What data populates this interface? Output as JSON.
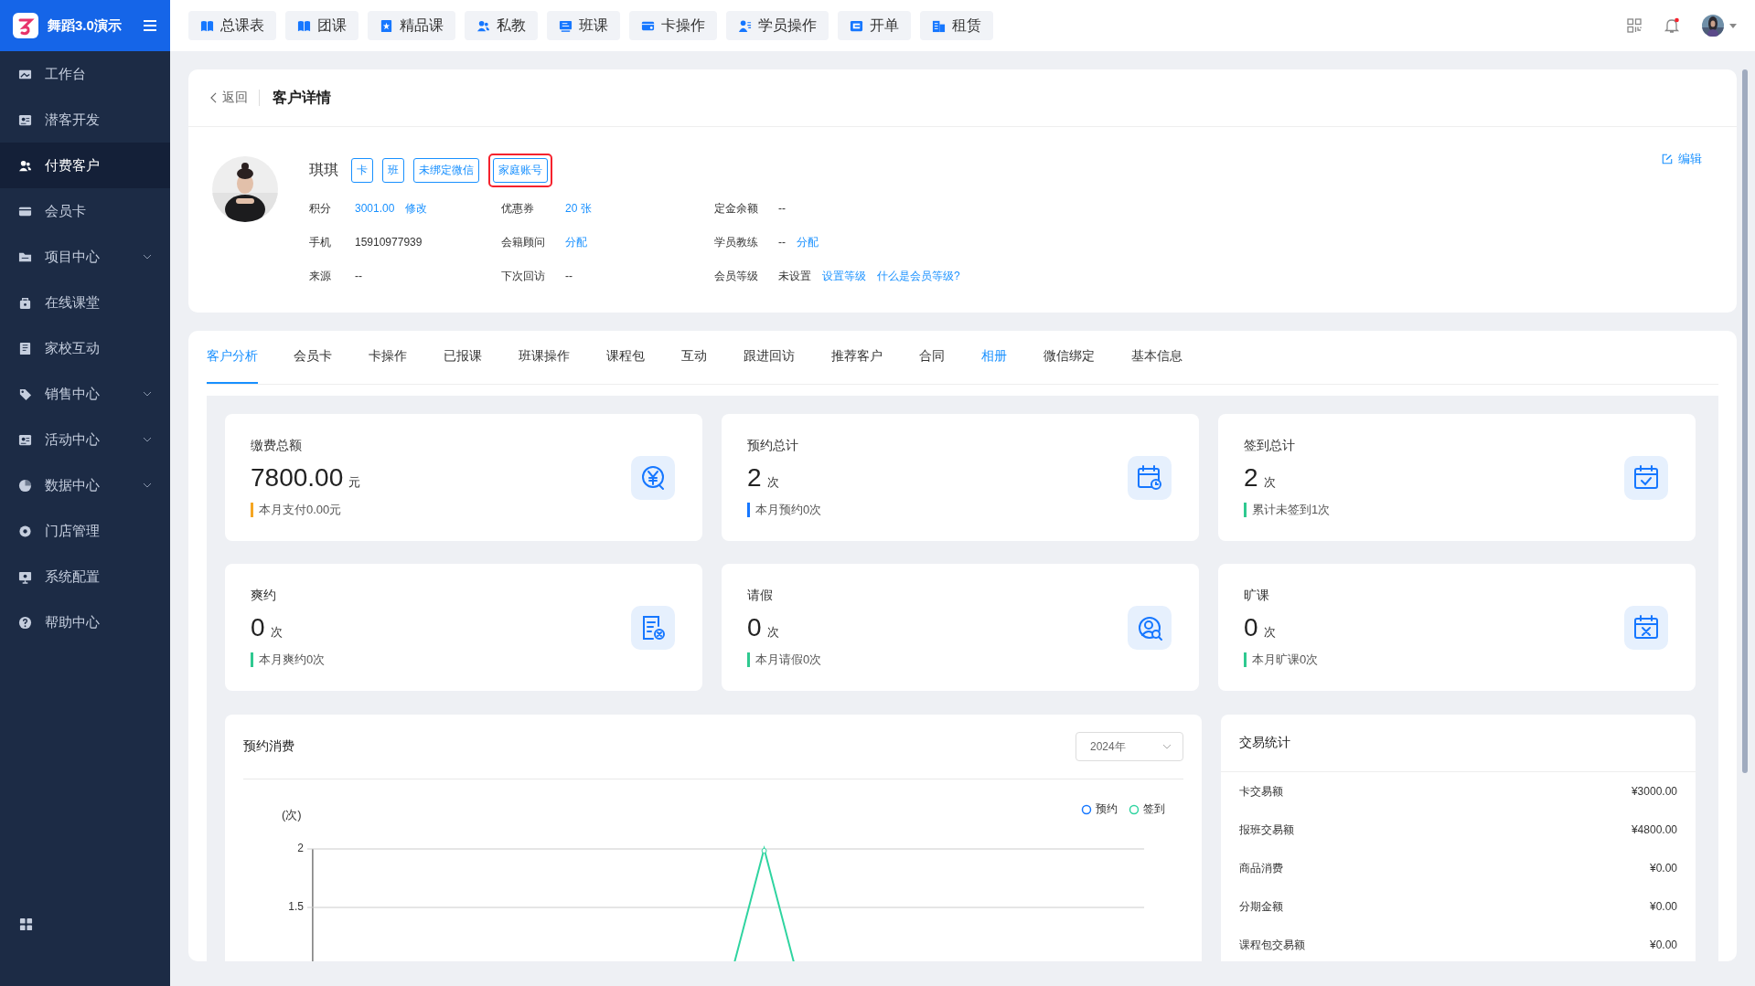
{
  "app": {
    "title": "舞蹈3.0演示"
  },
  "top_nav": [
    {
      "label": "总课表"
    },
    {
      "label": "团课"
    },
    {
      "label": "精品课"
    },
    {
      "label": "私教"
    },
    {
      "label": "班课"
    },
    {
      "label": "卡操作"
    },
    {
      "label": "学员操作"
    },
    {
      "label": "开单"
    },
    {
      "label": "租赁"
    }
  ],
  "notifications": {
    "unread": true
  },
  "sidebar": {
    "items": [
      {
        "label": "工作台",
        "expandable": false,
        "selected": false
      },
      {
        "label": "潜客开发",
        "expandable": false,
        "selected": false
      },
      {
        "label": "付费客户",
        "expandable": false,
        "selected": true
      },
      {
        "label": "会员卡",
        "expandable": false,
        "selected": false
      },
      {
        "label": "项目中心",
        "expandable": true,
        "selected": false
      },
      {
        "label": "在线课堂",
        "expandable": false,
        "selected": false
      },
      {
        "label": "家校互动",
        "expandable": false,
        "selected": false
      },
      {
        "label": "销售中心",
        "expandable": true,
        "selected": false
      },
      {
        "label": "活动中心",
        "expandable": true,
        "selected": false
      },
      {
        "label": "数据中心",
        "expandable": true,
        "selected": false
      },
      {
        "label": "门店管理",
        "expandable": false,
        "selected": false
      },
      {
        "label": "系统配置",
        "expandable": false,
        "selected": false
      },
      {
        "label": "帮助中心",
        "expandable": false,
        "selected": false
      }
    ]
  },
  "header": {
    "back": "返回",
    "title": "客户详情",
    "edit": "编辑"
  },
  "customer": {
    "name": "琪琪",
    "tags": [
      {
        "label": "卡",
        "highlighted": false
      },
      {
        "label": "班",
        "highlighted": false
      },
      {
        "label": "未绑定微信",
        "highlighted": false
      },
      {
        "label": "家庭账号",
        "highlighted": true
      }
    ],
    "fields": [
      [
        {
          "label": "积分",
          "value": "3001.00",
          "kind": "link",
          "action": "修改"
        },
        {
          "label": "优惠券",
          "value": "20 张",
          "kind": "link"
        },
        {
          "label": "定金余额",
          "value": "--",
          "kind": "text"
        }
      ],
      [
        {
          "label": "手机",
          "value": "15910977939",
          "kind": "text"
        },
        {
          "label": "会籍顾问",
          "value": "分配",
          "kind": "link"
        },
        {
          "label": "学员教练",
          "value": "--",
          "kind": "text",
          "action": "分配"
        }
      ],
      [
        {
          "label": "来源",
          "value": "--",
          "kind": "text"
        },
        {
          "label": "下次回访",
          "value": "--",
          "kind": "text"
        },
        {
          "label": "会员等级",
          "value": "未设置",
          "kind": "text",
          "action": "设置等级",
          "help": "什么是会员等级?"
        }
      ]
    ]
  },
  "tabs": [
    {
      "label": "客户分析",
      "selected": true,
      "highlighted": false
    },
    {
      "label": "会员卡",
      "selected": false,
      "highlighted": false
    },
    {
      "label": "卡操作",
      "selected": false,
      "highlighted": false
    },
    {
      "label": "已报课",
      "selected": false,
      "highlighted": false
    },
    {
      "label": "班课操作",
      "selected": false,
      "highlighted": false
    },
    {
      "label": "课程包",
      "selected": false,
      "highlighted": false
    },
    {
      "label": "互动",
      "selected": false,
      "highlighted": false
    },
    {
      "label": "跟进回访",
      "selected": false,
      "highlighted": false
    },
    {
      "label": "推荐客户",
      "selected": false,
      "highlighted": false
    },
    {
      "label": "合同",
      "selected": false,
      "highlighted": false
    },
    {
      "label": "相册",
      "selected": false,
      "highlighted": true
    },
    {
      "label": "微信绑定",
      "selected": false,
      "highlighted": false
    },
    {
      "label": "基本信息",
      "selected": false,
      "highlighted": false
    }
  ],
  "stats": [
    {
      "title": "缴费总额",
      "value": "7800.00",
      "unit": "元",
      "note": "本月支付0.00元",
      "color": "#f5a623"
    },
    {
      "title": "预约总计",
      "value": "2",
      "unit": "次",
      "note": "本月预约0次",
      "color": "#1677ff"
    },
    {
      "title": "签到总计",
      "value": "2",
      "unit": "次",
      "note": "累计未签到1次",
      "color": "#2fc990"
    },
    {
      "title": "爽约",
      "value": "0",
      "unit": "次",
      "note": "本月爽约0次",
      "color": "#2fc990"
    },
    {
      "title": "请假",
      "value": "0",
      "unit": "次",
      "note": "本月请假0次",
      "color": "#2fc990"
    },
    {
      "title": "旷课",
      "value": "0",
      "unit": "次",
      "note": "本月旷课0次",
      "color": "#2fc990"
    }
  ],
  "consumption": {
    "title": "预约消费",
    "year": "2024年",
    "unit": "(次)",
    "yticks": [
      "2",
      "1.5"
    ],
    "legend": [
      {
        "label": "预约",
        "color": "#1677ff"
      },
      {
        "label": "签到",
        "color": "#2fd4a0"
      }
    ]
  },
  "transactions": {
    "title": "交易统计",
    "rows": [
      {
        "label": "卡交易额",
        "value": "¥3000.00"
      },
      {
        "label": "报班交易额",
        "value": "¥4800.00"
      },
      {
        "label": "商品消费",
        "value": "¥0.00"
      },
      {
        "label": "分期金额",
        "value": "¥0.00"
      },
      {
        "label": "课程包交易额",
        "value": "¥0.00"
      }
    ]
  }
}
